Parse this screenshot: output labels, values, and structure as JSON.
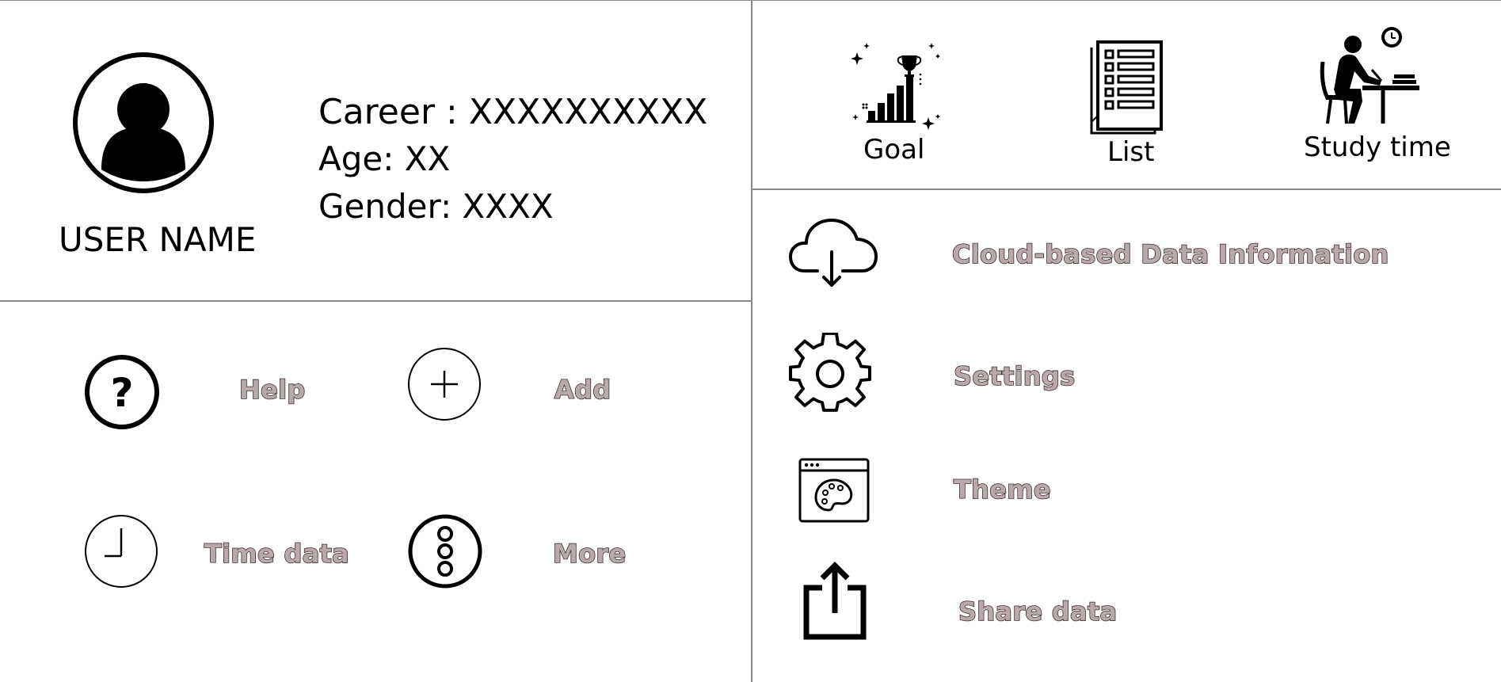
{
  "profile": {
    "user_name": "USER NAME",
    "career": "Career : XXXXXXXXXX",
    "age": "Age: XX",
    "gender": "Gender: XXXX"
  },
  "quick_actions": [
    {
      "label": "Help",
      "icon": "help-circle-icon"
    },
    {
      "label": "Add",
      "icon": "plus-circle-icon"
    },
    {
      "label": "Time data",
      "icon": "clock-icon"
    },
    {
      "label": "More",
      "icon": "more-vertical-icon"
    }
  ],
  "top_tools": [
    {
      "label": "Goal",
      "icon": "trophy-growth-icon"
    },
    {
      "label": "List",
      "icon": "checklist-icon"
    },
    {
      "label": "Study time",
      "icon": "studying-person-icon"
    }
  ],
  "menu": [
    {
      "label": "Cloud-based Data Information",
      "icon": "cloud-download-icon"
    },
    {
      "label": "Settings",
      "icon": "gear-icon"
    },
    {
      "label": "Theme",
      "icon": "palette-window-icon"
    },
    {
      "label": "Share data",
      "icon": "share-icon"
    }
  ],
  "colors": {
    "divider": "#8a8a8a",
    "label_fill": "#b9a9ab",
    "label_outline": "#3e2f31"
  }
}
